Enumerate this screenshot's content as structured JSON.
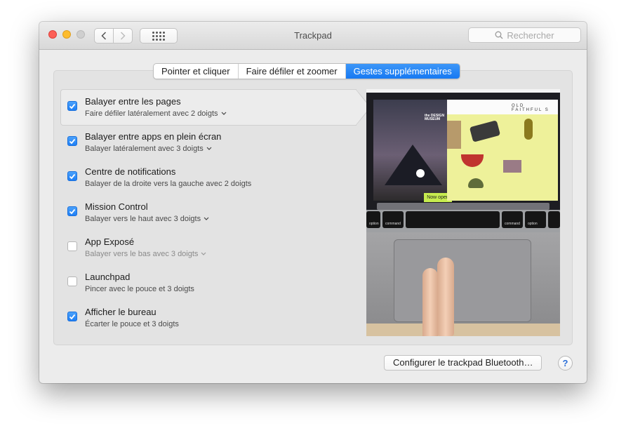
{
  "window": {
    "title": "Trackpad",
    "search_placeholder": "Rechercher"
  },
  "tabs": [
    {
      "label": "Pointer et cliquer",
      "active": false
    },
    {
      "label": "Faire défiler et zoomer",
      "active": false
    },
    {
      "label": "Gestes supplémentaires",
      "active": true
    }
  ],
  "gestures": [
    {
      "title": "Balayer entre les pages",
      "subtitle": "Faire défiler latéralement avec 2 doigts",
      "checked": true,
      "has_menu": true,
      "selected": true
    },
    {
      "title": "Balayer entre apps en plein écran",
      "subtitle": "Balayer latéralement avec 3 doigts",
      "checked": true,
      "has_menu": true
    },
    {
      "title": "Centre de notifications",
      "subtitle": "Balayer de la droite vers la gauche avec 2 doigts",
      "checked": true,
      "has_menu": false
    },
    {
      "title": "Mission Control",
      "subtitle": "Balayer vers le haut avec 3 doigts",
      "checked": true,
      "has_menu": true
    },
    {
      "title": "App Exposé",
      "subtitle": "Balayer vers le bas avec 3 doigts",
      "checked": false,
      "has_menu": true
    },
    {
      "title": "Launchpad",
      "subtitle": "Pincer avec le pouce et 3 doigts",
      "checked": false,
      "has_menu": false
    },
    {
      "title": "Afficher le bureau",
      "subtitle": "Écarter le pouce et 3 doigts",
      "checked": true,
      "has_menu": false
    }
  ],
  "preview": {
    "museum_text": "the DESIGN MUSEUM",
    "banner_text": "Now open",
    "site_text": "OLD FAITHFUL S",
    "keys": [
      "option",
      "command",
      "command",
      "option"
    ]
  },
  "footer": {
    "bluetooth_button": "Configurer le trackpad Bluetooth…",
    "help_button": "?"
  },
  "colors": {
    "accent": "#1f7ff5",
    "close": "#fc5f57",
    "minimize": "#fdbc2e"
  }
}
